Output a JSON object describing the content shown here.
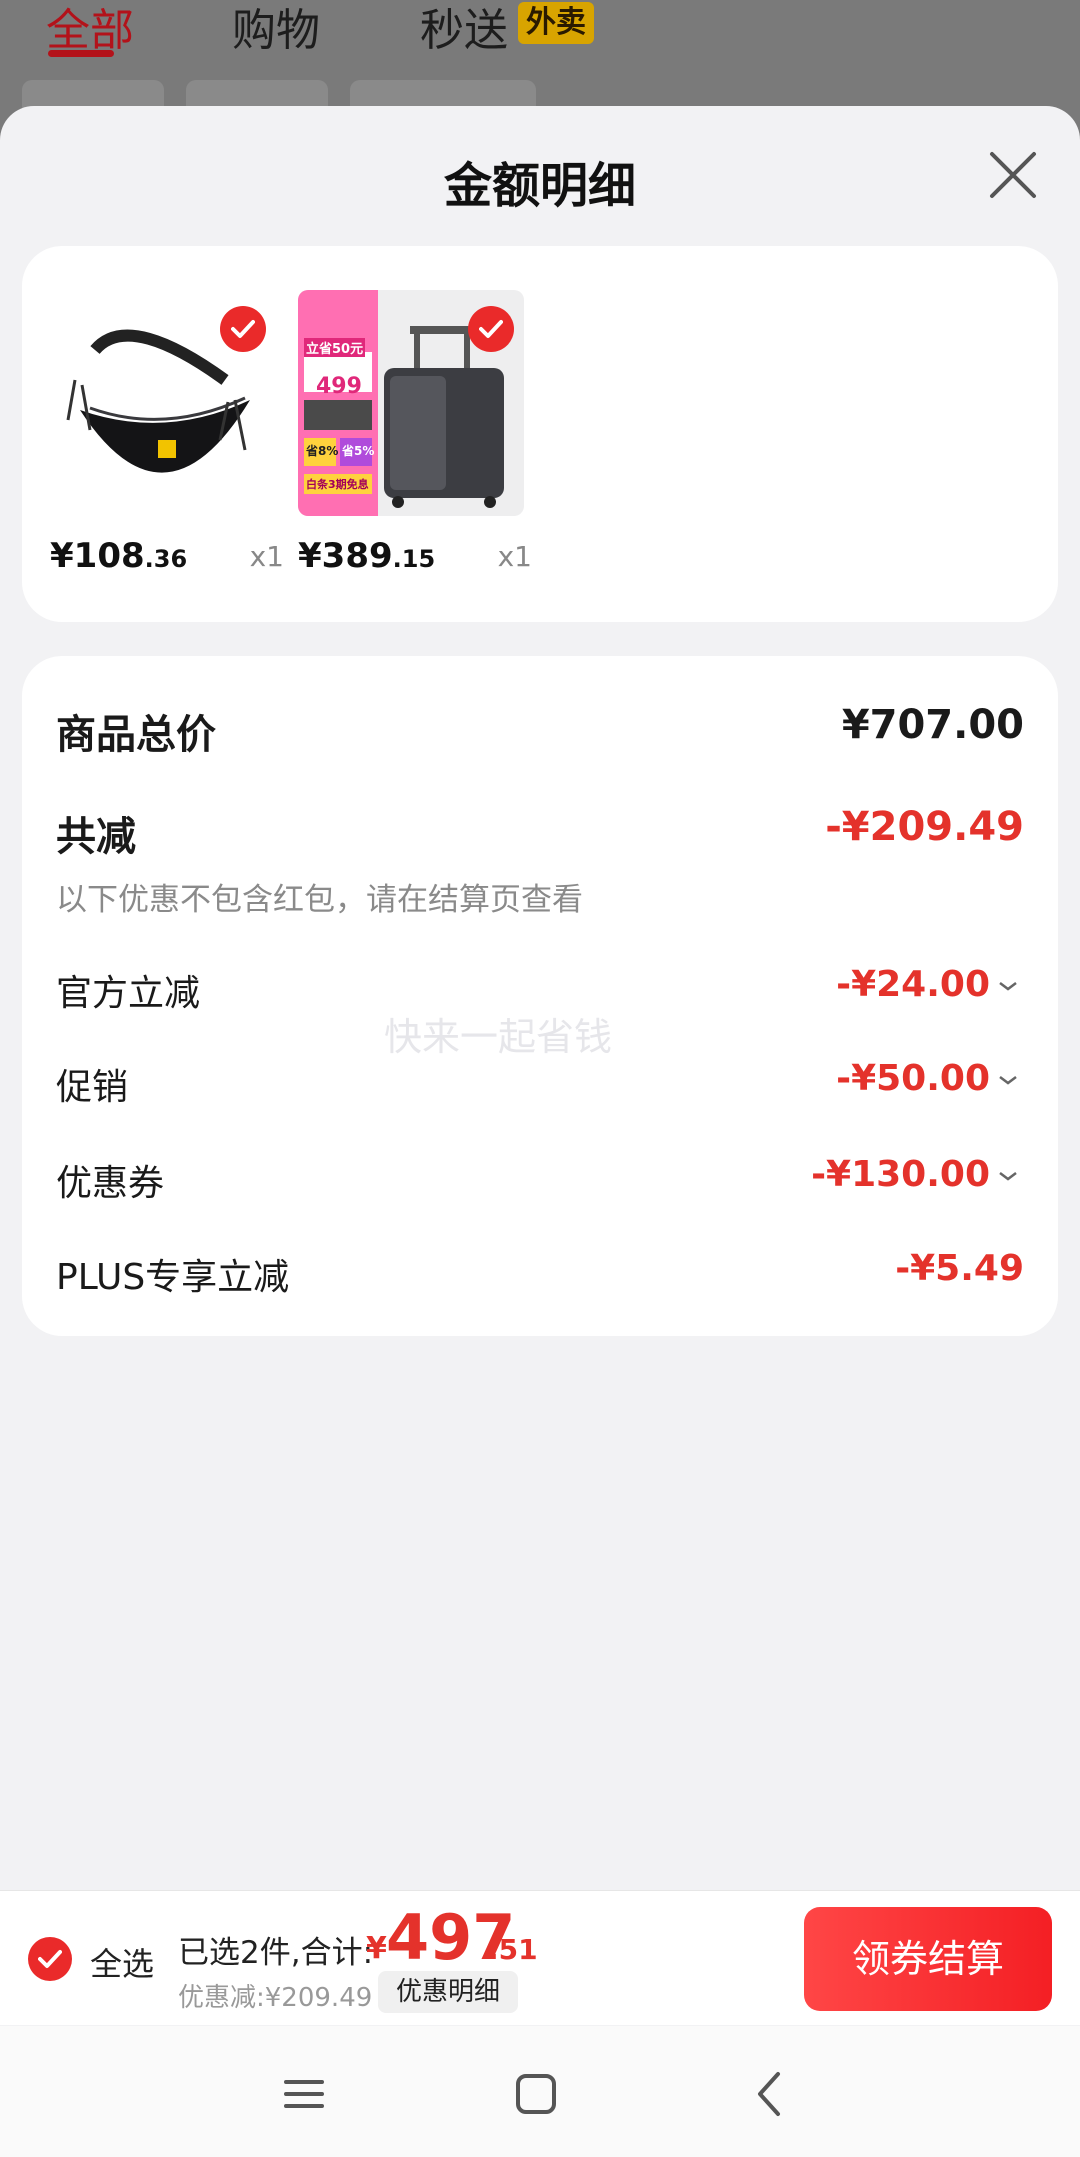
{
  "background": {
    "tabs": [
      {
        "label": "全部",
        "active": true
      },
      {
        "label": "购物",
        "active": false
      },
      {
        "label": "秒送",
        "active": false,
        "badge": "外卖"
      }
    ]
  },
  "sheet": {
    "title": "金额明细",
    "products": [
      {
        "price_int": "¥108",
        "price_dec": ".36",
        "qty": "x1",
        "checked": true,
        "image": "black-crossbody-bag"
      },
      {
        "price_int": "¥389",
        "price_dec": ".15",
        "qty": "x1",
        "checked": true,
        "image": "gray-suitcase-with-promo"
      }
    ],
    "promo_image_text": {
      "headline": "立省50元",
      "price": "499",
      "tag1": "省8%",
      "tag2": "省5%",
      "footer": "白条3期免息"
    },
    "summary": {
      "total_label": "商品总价",
      "total_value": "¥707.00",
      "reduce_label": "共减",
      "reduce_value": "-¥209.49",
      "note": "以下优惠不包含红包，请在结算页查看",
      "items": [
        {
          "label": "官方立减",
          "value": "-¥24.00",
          "expandable": true
        },
        {
          "label": "促销",
          "value": "-¥50.00",
          "expandable": true
        },
        {
          "label": "优惠券",
          "value": "-¥130.00",
          "expandable": true
        },
        {
          "label": "PLUS专享立减",
          "value": "-¥5.49",
          "expandable": false
        }
      ],
      "watermark": "快来一起省钱"
    }
  },
  "checkout": {
    "select_all": "全选",
    "selected_text": "已选2件,合计:",
    "currency": "¥",
    "total_int": "497",
    "total_dec": ".51",
    "discount_text": "优惠减:¥209.49",
    "discount_detail_btn": "优惠明细",
    "pay_button": "领券结算"
  },
  "colors": {
    "accent_red": "#e4322b",
    "button_red": "#f41f24"
  }
}
